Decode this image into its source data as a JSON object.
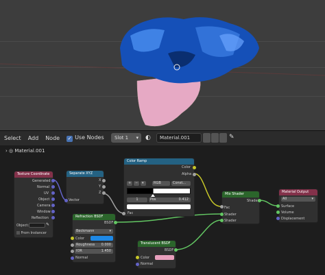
{
  "header": {
    "menu": [
      "Select",
      "Add",
      "Node"
    ],
    "use_nodes_label": "Use Nodes",
    "slot_label": "Slot 1",
    "material_name": "Material.001"
  },
  "breadcrumb": {
    "label": "Material.001"
  },
  "nodes": {
    "texcoord": {
      "title": "Texture Coordinate",
      "outputs": [
        "Generated",
        "Normal",
        "UV",
        "Object",
        "Camera",
        "Window",
        "Reflection"
      ],
      "object_label": "Object:",
      "from_instancer": "From Instancer"
    },
    "separate": {
      "title": "Separate XYZ",
      "outputs": [
        "X",
        "Y",
        "Z"
      ],
      "input": "Vector"
    },
    "ramp": {
      "title": "Color Ramp",
      "outputs": [
        "Color",
        "Alpha"
      ],
      "mode": "RGB",
      "interp": "Const...",
      "index": "1",
      "pos_label": "Pos",
      "pos_value": "0.412",
      "input": "Fac"
    },
    "refraction": {
      "title": "Refraction BSDF",
      "output": "BSDF",
      "distribution": "Beckmann",
      "color_label": "Color",
      "roughness_label": "Roughness",
      "roughness_value": "0.000",
      "ior_label": "IOR",
      "ior_value": "1.450",
      "normal_label": "Normal"
    },
    "translucent": {
      "title": "Translucent BSDF",
      "output": "BSDF",
      "color_label": "Color",
      "normal_label": "Normal"
    },
    "mix": {
      "title": "Mix Shader",
      "output": "Shader",
      "inputs": [
        "Fac",
        "Shader",
        "Shader"
      ]
    },
    "output": {
      "title": "Material Output",
      "target": "All",
      "inputs": [
        "Surface",
        "Volume",
        "Displacement"
      ]
    }
  },
  "colors": {
    "node_header_input": "#83314a",
    "node_header_converter": "#246283",
    "node_header_shader": "#2b652b",
    "refraction_color": "#1e88e5",
    "translucent_color": "#e8a0bd"
  }
}
